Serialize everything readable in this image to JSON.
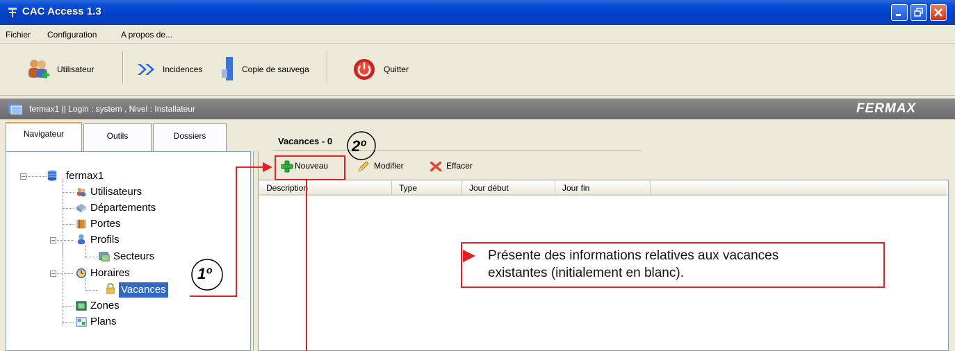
{
  "window": {
    "title": "CAC Access 1.3"
  },
  "menu": {
    "items": [
      "Fichier",
      "Configuration",
      "A propos de..."
    ]
  },
  "toolbar": {
    "buttons": [
      {
        "label": "Utilisateur",
        "icon": "users-icon"
      },
      {
        "label": "Incidences",
        "icon": "double-arrow-icon"
      },
      {
        "label": "Copie de sauvega",
        "icon": "backup-icon"
      },
      {
        "label": "Quitter",
        "icon": "power-icon"
      }
    ]
  },
  "infobar": {
    "text": "fermax1  || Login : system , Nivel : Installateur",
    "logo": "FERMAX"
  },
  "tabs": [
    "Navigateur",
    "Outils",
    "Dossiers"
  ],
  "tree": {
    "root": "fermax1",
    "items": [
      {
        "label": "Utilisateurs",
        "icon": "users-icon"
      },
      {
        "label": "Départements",
        "icon": "departments-icon"
      },
      {
        "label": "Portes",
        "icon": "door-icon"
      },
      {
        "label": "Profils",
        "icon": "profile-icon"
      },
      {
        "label": "Secteurs",
        "icon": "sectors-icon"
      },
      {
        "label": "Horaires",
        "icon": "clock-icon"
      },
      {
        "label": "Vacances",
        "icon": "lock-icon"
      },
      {
        "label": "Zones",
        "icon": "zones-icon"
      },
      {
        "label": "Plans",
        "icon": "plans-icon"
      }
    ]
  },
  "right_panel": {
    "header": "Vacances - 0",
    "actions": [
      {
        "label": "Nouveau",
        "icon": "plus-icon"
      },
      {
        "label": "Modifier",
        "icon": "pencil-icon"
      },
      {
        "label": "Effacer",
        "icon": "delete-icon"
      }
    ],
    "columns": [
      "Description",
      "Type",
      "Jour début",
      "Jour fin"
    ]
  },
  "annotations": {
    "step1": "1º",
    "step2": "2º",
    "callout_line1": "Présente des informations relatives aux vacances",
    "callout_line2": "existantes (initialement en blanc).",
    "accent_color": "#e31e24"
  }
}
